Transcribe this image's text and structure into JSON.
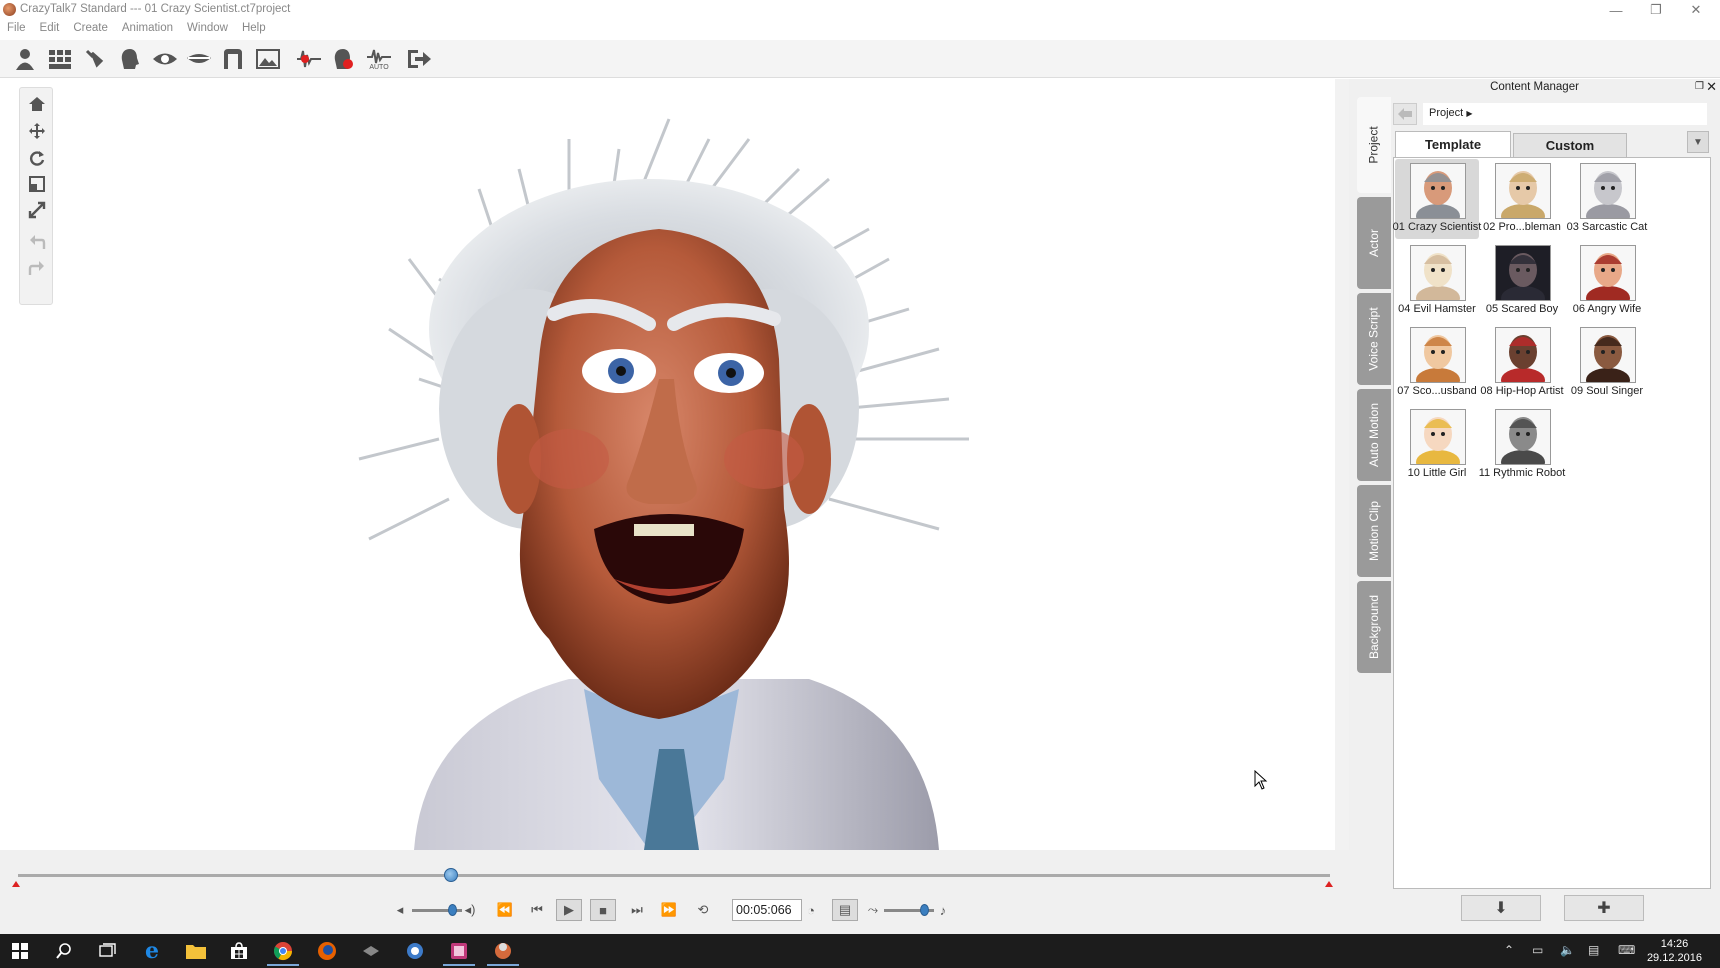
{
  "window": {
    "title": "CrazyTalk7 Standard --- 01 Crazy Scientist.ct7project",
    "controls": {
      "minimize": "—",
      "restore": "❐",
      "close": "✕"
    }
  },
  "menu": [
    "File",
    "Edit",
    "Create",
    "Animation",
    "Window",
    "Help"
  ],
  "toolbar": {
    "icons": [
      "actor-icon",
      "grid-icon",
      "hand-wand-icon",
      "head-icon",
      "eye-icon",
      "mouth-icon",
      "face-outline-icon",
      "image-icon",
      "audio-wave-icon",
      "record-icon",
      "auto-wave-icon",
      "export-icon"
    ],
    "auto_label": "AUTO"
  },
  "viewport_tools": [
    "home-icon",
    "move-icon",
    "rotate-icon",
    "scale-icon",
    "fit-icon",
    "undo-icon",
    "redo-icon"
  ],
  "content_manager": {
    "title": "Content Manager",
    "path": "Project",
    "tabs": {
      "template": "Template",
      "custom": "Custom"
    },
    "side_tabs": [
      "Project",
      "Actor",
      "Voice Script",
      "Auto Motion",
      "Motion Clip",
      "Background"
    ],
    "items": [
      {
        "label": "01 Crazy Scientist",
        "selected": true
      },
      {
        "label": "02 Pro...bleman"
      },
      {
        "label": "03 Sarcastic Cat"
      },
      {
        "label": "04 Evil Hamster"
      },
      {
        "label": "05 Scared Boy"
      },
      {
        "label": "06 Angry Wife"
      },
      {
        "label": "07 Sco...usband"
      },
      {
        "label": "08 Hip-Hop Artist"
      },
      {
        "label": "09 Soul Singer"
      },
      {
        "label": "10 Little Girl"
      },
      {
        "label": "11 Rythmic Robot"
      }
    ],
    "footer": {
      "download": "⬇",
      "add": "✚"
    }
  },
  "playback": {
    "time": "00:05:066",
    "scrub_progress": 0.33,
    "volume_level": 0.8,
    "speed_level": 0.8
  },
  "taskbar": {
    "clock_time": "14:26",
    "clock_date": "29.12.2016"
  }
}
